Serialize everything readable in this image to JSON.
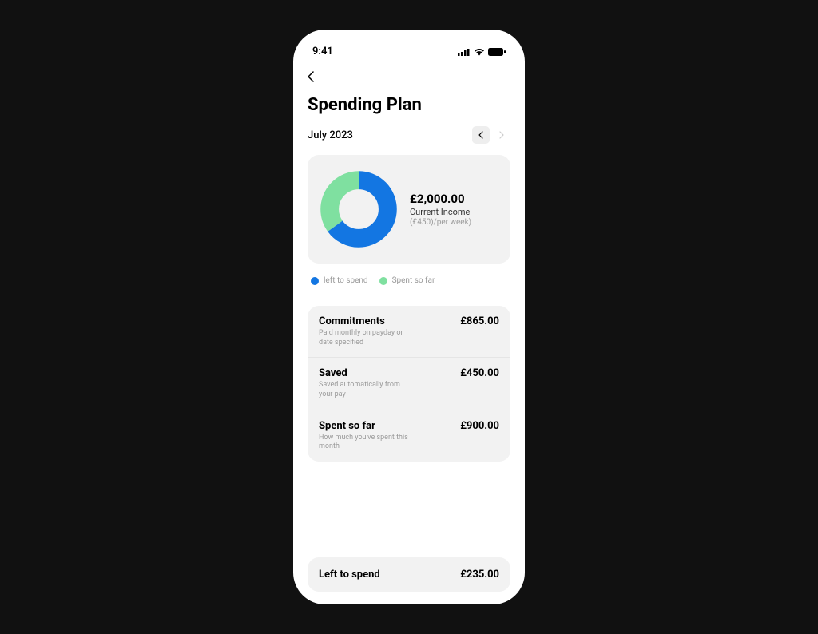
{
  "status": {
    "time": "9:41"
  },
  "header": {
    "title": "Spending Plan",
    "month": "July 2023"
  },
  "chart_data": {
    "type": "pie",
    "title": "Current Income",
    "series": [
      {
        "name": "left to spend",
        "value": 65,
        "color": "#1376e2"
      },
      {
        "name": "Spent so far",
        "value": 35,
        "color": "#7fe0a0"
      }
    ]
  },
  "income": {
    "amount": "£2,000.00",
    "label": "Current Income",
    "sublabel": "(£450)/per week)"
  },
  "legend": [
    {
      "label": "left to spend",
      "color": "#1376e2"
    },
    {
      "label": "Spent so far",
      "color": "#7fe0a0"
    }
  ],
  "rows": [
    {
      "title": "Commitments",
      "subtitle": "Paid monthly on payday or date specified",
      "value": "£865.00"
    },
    {
      "title": "Saved",
      "subtitle": "Saved automatically from your pay",
      "value": "£450.00"
    },
    {
      "title": "Spent so far",
      "subtitle": "How much you've spent this month",
      "value": "£900.00"
    }
  ],
  "footer": {
    "title": "Left to spend",
    "value": "£235.00"
  }
}
